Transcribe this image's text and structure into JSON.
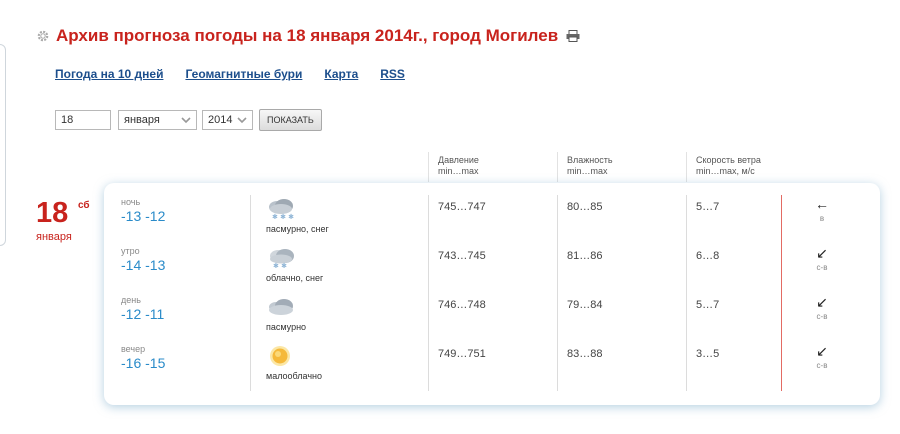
{
  "title": "Архив прогноза погоды на 18 января 2014г., город Могилев",
  "nav": [
    "Погода на 10 дней",
    "Геомагнитные бури",
    "Карта",
    "RSS"
  ],
  "controls": {
    "day": "18",
    "month": "января",
    "year": "2014",
    "show_button": "ПОКАЗАТЬ"
  },
  "columns": {
    "pressure": {
      "line1": "Давление",
      "line2": "min…max"
    },
    "humidity": {
      "line1": "Влажность",
      "line2": "min…max"
    },
    "wind": {
      "line1": "Скорость ветра",
      "line2": "min…max, м/с"
    }
  },
  "date": {
    "day": "18",
    "dow": "сб",
    "month": "января"
  },
  "rows": [
    {
      "period": "ночь",
      "temp": "-13 -12",
      "icon": "cloud-snow-icon",
      "desc": "пасмурно, снег",
      "pressure": "745…747",
      "humidity": "80…85",
      "wind": "5…7",
      "arrow": "←",
      "dir": "в"
    },
    {
      "period": "утро",
      "temp": "-14 -13",
      "icon": "partly-cloudy-snow-icon",
      "desc": "облачно, снег",
      "pressure": "743…745",
      "humidity": "81…86",
      "wind": "6…8",
      "arrow": "↙",
      "dir": "с-в"
    },
    {
      "period": "день",
      "temp": "-12 -11",
      "icon": "overcast-icon",
      "desc": "пасмурно",
      "pressure": "746…748",
      "humidity": "79…84",
      "wind": "5…7",
      "arrow": "↙",
      "dir": "с-в"
    },
    {
      "period": "вечер",
      "temp": "-16 -15",
      "icon": "sun-icon",
      "desc": "малооблачно",
      "pressure": "749…751",
      "humidity": "83…88",
      "wind": "3…5",
      "arrow": "↙",
      "dir": "с-в"
    }
  ],
  "colors": {
    "accent": "#c8231d",
    "link": "#1c4e8c",
    "temp": "#2a8bc9"
  }
}
